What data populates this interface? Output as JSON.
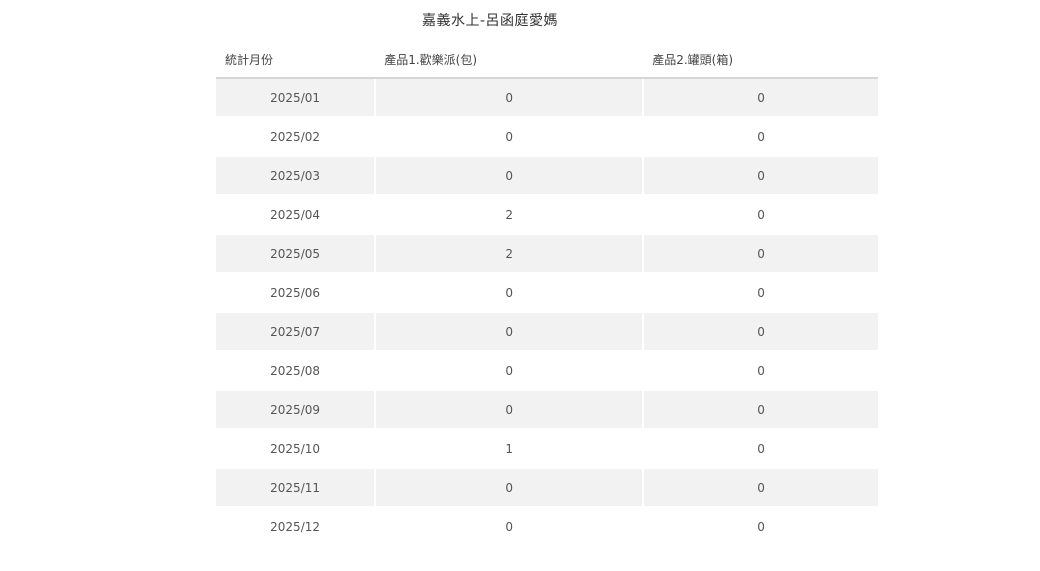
{
  "title": "嘉義水上-呂函庭愛媽",
  "columns": {
    "month": "統計月份",
    "product1": "產品1.歡樂派(包)",
    "product2": "產品2.罐頭(箱)"
  },
  "rows": [
    {
      "month": "2025/01",
      "product1": "0",
      "product2": "0"
    },
    {
      "month": "2025/02",
      "product1": "0",
      "product2": "0"
    },
    {
      "month": "2025/03",
      "product1": "0",
      "product2": "0"
    },
    {
      "month": "2025/04",
      "product1": "2",
      "product2": "0"
    },
    {
      "month": "2025/05",
      "product1": "2",
      "product2": "0"
    },
    {
      "month": "2025/06",
      "product1": "0",
      "product2": "0"
    },
    {
      "month": "2025/07",
      "product1": "0",
      "product2": "0"
    },
    {
      "month": "2025/08",
      "product1": "0",
      "product2": "0"
    },
    {
      "month": "2025/09",
      "product1": "0",
      "product2": "0"
    },
    {
      "month": "2025/10",
      "product1": "1",
      "product2": "0"
    },
    {
      "month": "2025/11",
      "product1": "0",
      "product2": "0"
    },
    {
      "month": "2025/12",
      "product1": "0",
      "product2": "0"
    }
  ]
}
